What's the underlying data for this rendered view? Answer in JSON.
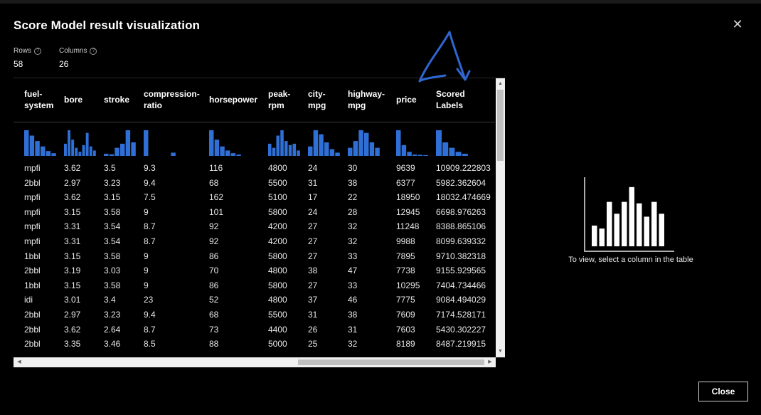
{
  "dialog": {
    "title": "Score Model result visualization",
    "close_icon": "close-icon",
    "close_button": "Close"
  },
  "stats": {
    "rows_label": "Rows",
    "rows_value": "58",
    "columns_label": "Columns",
    "columns_value": "26"
  },
  "table": {
    "columns": [
      "fuel-\nsystem",
      "bore",
      "stroke",
      "compression-\nratio",
      "horsepower",
      "peak-\nrpm",
      "city-\nmpg",
      "highway-\nmpg",
      "price",
      "Scored\nLabels"
    ],
    "rows": [
      [
        "mpfi",
        "3.62",
        "3.5",
        "9.3",
        "116",
        "4800",
        "24",
        "30",
        "9639",
        "10909.222803"
      ],
      [
        "2bbl",
        "2.97",
        "3.23",
        "9.4",
        "68",
        "5500",
        "31",
        "38",
        "6377",
        "5982.362604"
      ],
      [
        "mpfi",
        "3.62",
        "3.15",
        "7.5",
        "162",
        "5100",
        "17",
        "22",
        "18950",
        "18032.474669"
      ],
      [
        "mpfi",
        "3.15",
        "3.58",
        "9",
        "101",
        "5800",
        "24",
        "28",
        "12945",
        "6698.976263"
      ],
      [
        "mpfi",
        "3.31",
        "3.54",
        "8.7",
        "92",
        "4200",
        "27",
        "32",
        "11248",
        "8388.865106"
      ],
      [
        "mpfi",
        "3.31",
        "3.54",
        "8.7",
        "92",
        "4200",
        "27",
        "32",
        "9988",
        "8099.639332"
      ],
      [
        "1bbl",
        "3.15",
        "3.58",
        "9",
        "86",
        "5800",
        "27",
        "33",
        "7895",
        "9710.382318"
      ],
      [
        "2bbl",
        "3.19",
        "3.03",
        "9",
        "70",
        "4800",
        "38",
        "47",
        "7738",
        "9155.929565"
      ],
      [
        "1bbl",
        "3.15",
        "3.58",
        "9",
        "86",
        "5800",
        "27",
        "33",
        "10295",
        "7404.734466"
      ],
      [
        "idi",
        "3.01",
        "3.4",
        "23",
        "52",
        "4800",
        "37",
        "46",
        "7775",
        "9084.494029"
      ],
      [
        "2bbl",
        "2.97",
        "3.23",
        "9.4",
        "68",
        "5500",
        "31",
        "38",
        "7609",
        "7174.528171"
      ],
      [
        "2bbl",
        "3.62",
        "2.64",
        "8.7",
        "73",
        "4400",
        "26",
        "31",
        "7603",
        "5430.302227"
      ],
      [
        "2bbl",
        "3.35",
        "3.46",
        "8.5",
        "88",
        "5000",
        "25",
        "32",
        "8189",
        "8487.219915"
      ]
    ],
    "histograms": [
      [
        0.95,
        0.75,
        0.55,
        0.35,
        0.18,
        0.1
      ],
      [
        0.45,
        0.95,
        0.6,
        0.3,
        0.15,
        0.4,
        0.85,
        0.35,
        0.2
      ],
      [
        0.08,
        0.06,
        0.3,
        0.45,
        0.95,
        0.5
      ],
      [
        0.95,
        0.0,
        0.0,
        0.0,
        0.0,
        0.12
      ],
      [
        0.95,
        0.6,
        0.35,
        0.2,
        0.1,
        0.05
      ],
      [
        0.45,
        0.3,
        0.75,
        0.95,
        0.55,
        0.4,
        0.45,
        0.2
      ],
      [
        0.35,
        0.95,
        0.8,
        0.5,
        0.25,
        0.12
      ],
      [
        0.3,
        0.55,
        0.95,
        0.85,
        0.5,
        0.3
      ],
      [
        0.95,
        0.4,
        0.15,
        0.05,
        0.04,
        0.03
      ],
      [
        0.95,
        0.5,
        0.3,
        0.15,
        0.08
      ]
    ],
    "accent_color": "#2f6fd6"
  },
  "side_panel": {
    "message": "To view, select a column in the table",
    "placeholder_bars": [
      0.28,
      0.24,
      0.6,
      0.44,
      0.6,
      0.8,
      0.58,
      0.4,
      0.6,
      0.44
    ]
  }
}
